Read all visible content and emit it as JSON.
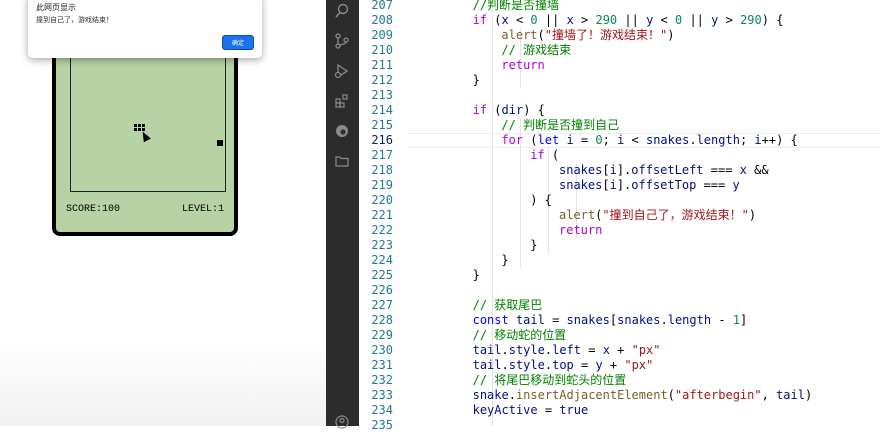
{
  "game": {
    "score_text": "SCORE:100",
    "level_text": "LEVEL:1"
  },
  "dialog": {
    "title": "此网页显示",
    "message": "撞到自己了，游戏结束！",
    "ok_label": "确定"
  },
  "activity_bar": {
    "icons": [
      "search-icon",
      "source-control-icon",
      "run-debug-icon",
      "extensions-icon",
      "edge-icon",
      "folder-icon",
      "account-icon"
    ]
  },
  "editor": {
    "current_line": 216,
    "lines": [
      {
        "n": 207,
        "t": "//判断是否撞墙"
      },
      {
        "n": 208,
        "t": "if (x < 0 || x > 290 || y < 0 || y > 290) {"
      },
      {
        "n": 209,
        "t": "alert(\"撞墙了！游戏结束！\")"
      },
      {
        "n": 210,
        "t": "// 游戏结束"
      },
      {
        "n": 211,
        "t": "return"
      },
      {
        "n": 212,
        "t": "}"
      },
      {
        "n": 213,
        "t": ""
      },
      {
        "n": 214,
        "t": "if (dir) {"
      },
      {
        "n": 215,
        "t": "// 判断是否撞到自己"
      },
      {
        "n": 216,
        "t": "for (let i = 0; i < snakes.length; i++) {"
      },
      {
        "n": 217,
        "t": "if ("
      },
      {
        "n": 218,
        "t": "snakes[i].offsetLeft === x &&"
      },
      {
        "n": 219,
        "t": "snakes[i].offsetTop === y"
      },
      {
        "n": 220,
        "t": ") {"
      },
      {
        "n": 221,
        "t": "alert(\"撞到自己了，游戏结束！\")"
      },
      {
        "n": 222,
        "t": "return"
      },
      {
        "n": 223,
        "t": "}"
      },
      {
        "n": 224,
        "t": "}"
      },
      {
        "n": 225,
        "t": "}"
      },
      {
        "n": 226,
        "t": ""
      },
      {
        "n": 227,
        "t": "// 获取尾巴"
      },
      {
        "n": 228,
        "t": "const tail = snakes[snakes.length - 1]"
      },
      {
        "n": 229,
        "t": "// 移动蛇的位置"
      },
      {
        "n": 230,
        "t": "tail.style.left = x + \"px\""
      },
      {
        "n": 231,
        "t": "tail.style.top = y + \"px\""
      },
      {
        "n": 232,
        "t": "// 将尾巴移动到蛇头的位置"
      },
      {
        "n": 233,
        "t": "snake.insertAdjacentElement(\"afterbegin\", tail)"
      },
      {
        "n": 234,
        "t": "keyActive = true"
      },
      {
        "n": 235,
        "t": ""
      }
    ]
  }
}
